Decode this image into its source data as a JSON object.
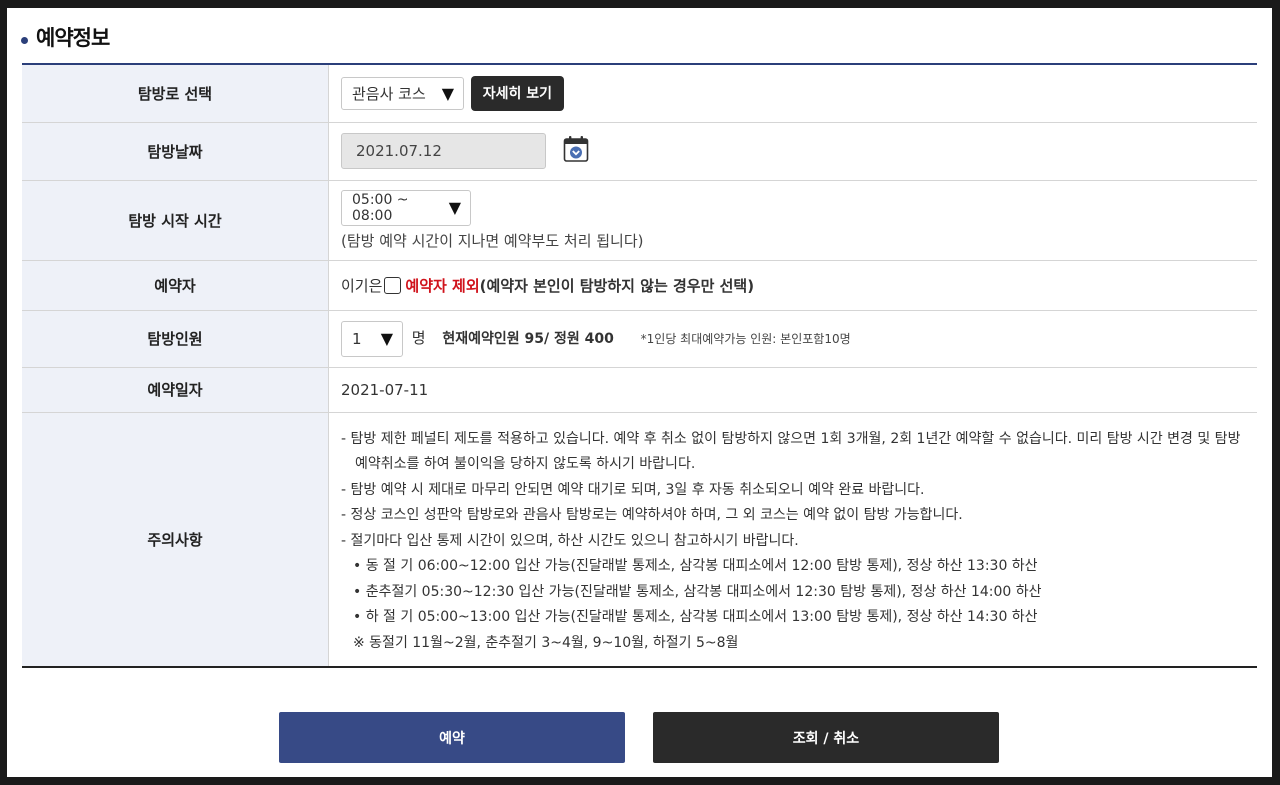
{
  "section": {
    "title": "예약정보"
  },
  "rows": {
    "trail": {
      "label": "탐방로 선택",
      "selected": "관음사 코스",
      "detail_button": "자세히 보기"
    },
    "date": {
      "label": "탐방날짜",
      "value": "2021.07.12",
      "icon": "calendar-icon"
    },
    "time": {
      "label": "탐방 시작 시간",
      "selected": "05:00 ~ 08:00",
      "hint": "(탐방 예약 시간이 지나면 예약부도 처리 됩니다)"
    },
    "reserver": {
      "label": "예약자",
      "name": "이기은",
      "exclude_label": "예약자 제외",
      "exclude_desc": "(예약자 본인이 탐방하지 않는 경우만 선택)"
    },
    "people": {
      "label": "탐방인원",
      "selected": "1",
      "unit": "명",
      "status": "현재예약인원 95/ 정원 400",
      "note": "*1인당 최대예약가능 인원: 본인포함10명"
    },
    "reserve_date": {
      "label": "예약일자",
      "value": "2021-07-11"
    },
    "notice": {
      "label": "주의사항",
      "lines": [
        "-  탐방 제한 페널티 제도를 적용하고 있습니다. 예약 후 취소 없이 탐방하지 않으면 1회 3개월, 2회 1년간 예약할 수 없습니다. 미리 탐방 시간 변경 및 탐방",
        "예약취소를 하여 불이익을 당하지 않도록 하시기 바랍니다.",
        "-  탐방 예약 시 제대로 마무리 안되면 예약 대기로 되며, 3일 후 자동 취소되오니 예약 완료 바랍니다.",
        "-  정상 코스인 성판악 탐방로와 관음사 탐방로는 예약하셔야 하며, 그 외 코스는 예약 없이 탐방 가능합니다.",
        "-  절기마다 입산 통제 시간이 있으며, 하산 시간도 있으니 참고하시기 바랍니다.",
        "• 동 절 기 06:00~12:00 입산 가능(진달래밭 통제소, 삼각봉 대피소에서 12:00 탐방 통제), 정상 하산 13:30 하산",
        "• 춘추절기 05:30~12:30 입산 가능(진달래밭 통제소, 삼각봉 대피소에서 12:30 탐방 통제), 정상 하산 14:00 하산",
        "• 하 절 기 05:00~13:00 입산 가능(진달래밭 통제소, 삼각봉 대피소에서 13:00 탐방 통제), 정상 하산 14:30 하산",
        "※ 동절기 11월~2월, 춘추절기 3~4월, 9~10월, 하절기 5~8월"
      ]
    }
  },
  "buttons": {
    "reserve": "예약",
    "lookup_cancel": "조회 / 취소"
  },
  "colors": {
    "primary": "#374a86",
    "dark": "#2a2a2a",
    "accent_red": "#d0121b",
    "label_bg": "#eef1f8"
  }
}
